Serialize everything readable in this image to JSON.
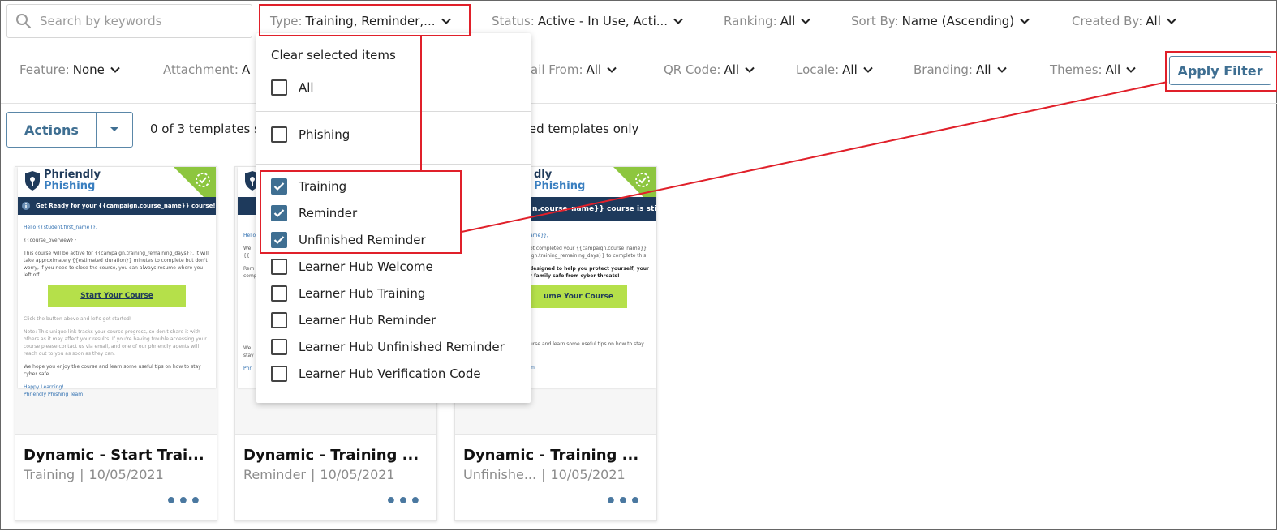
{
  "search": {
    "placeholder": "Search by keywords"
  },
  "filters_row1": [
    {
      "label": "Type:",
      "value": "Training, Reminder,..."
    },
    {
      "label": "Status:",
      "value": "Active - In Use, Acti..."
    },
    {
      "label": "Ranking:",
      "value": "All"
    },
    {
      "label": "Sort By:",
      "value": "Name (Ascending)"
    },
    {
      "label": "Created By:",
      "value": "All"
    }
  ],
  "filters_row2": [
    {
      "label": "Feature:",
      "value": "None"
    },
    {
      "label": "Attachment:",
      "value": "A"
    },
    {
      "label": "ail From:",
      "value": "All"
    },
    {
      "label": "QR Code:",
      "value": "All"
    },
    {
      "label": "Locale:",
      "value": "All"
    },
    {
      "label": "Branding:",
      "value": "All"
    },
    {
      "label": "Themes:",
      "value": "All"
    }
  ],
  "apply_filter_label": "Apply Filter",
  "actions_label": "Actions",
  "templates_count_text": "0 of 3 templates s",
  "templates_only_text": "ted templates only",
  "type_dropdown": {
    "clear_label": "Clear selected items",
    "all_label": "All",
    "items": [
      {
        "label": "Phishing",
        "checked": false
      },
      {
        "label": "Training",
        "checked": true
      },
      {
        "label": "Reminder",
        "checked": true
      },
      {
        "label": "Unfinished Reminder",
        "checked": true
      },
      {
        "label": "Learner Hub Welcome",
        "checked": false
      },
      {
        "label": "Learner Hub Training",
        "checked": false
      },
      {
        "label": "Learner Hub Reminder",
        "checked": false
      },
      {
        "label": "Learner Hub Unfinished Reminder",
        "checked": false
      },
      {
        "label": "Learner Hub Verification Code",
        "checked": false
      }
    ]
  },
  "cards": [
    {
      "title": "Dynamic - Start Trai...",
      "type": "Training",
      "date": "10/05/2021",
      "preview": {
        "brand_line1": "Phriendly",
        "brand_line2": "Phishing",
        "banner": "Get Ready for your {{campaign.course_name}} course!",
        "greeting": "Hello {{student.first_name}},",
        "overview": "{{course_overview}}",
        "para1": "This course will be active for {{campaign.training_remaining_days}}. It will take approximately {{estimated_duration}} minutes to complete but don't worry, if you need to close the course, you can always resume where you left off.",
        "button": "Start Your Course",
        "para2": "Click the button above and let's get started!",
        "para3": "Note: This unique link tracks your course progress, so don't share it with others as it may affect your results. If you're having trouble accessing your course please contact us via email, and one of our phriendly agents will reach out to you as soon as they can.",
        "para4": "We hope you enjoy the course and learn some useful tips on how to stay cyber safe.",
        "signoff1": "Happy Learning!",
        "signoff2": "Phriendly Phishing Team"
      }
    },
    {
      "title": "Dynamic - Training ...",
      "type": "Reminder",
      "date": "10/05/2021",
      "preview": {
        "brand_line1": "Phriendly",
        "brand_line2": "Phishing",
        "line1": "Hello",
        "line2": "We",
        "line3": "{{",
        "line4": "Rem",
        "line5": "comp",
        "line6": "We",
        "line7": "stay",
        "line8": "Phri"
      }
    },
    {
      "title": "Dynamic - Training ...",
      "type": "Unfinishe...",
      "date": "10/05/2021",
      "preview": {
        "brand_line1": "dly",
        "brand_line2": "Phishing",
        "banner": "n.course_name}} course is still",
        "greeting": "ame}},",
        "para1": "ot completed your {{campaign.course_name}}",
        "para1b": "ign.training_remaining_days}} to complete this",
        "para2": "designed to help you protect yourself, your",
        "para2b": "r family safe from cyber threats!",
        "button": "ume Your Course",
        "para3": "urse and learn some useful tips on how to stay",
        "signoff": "m"
      }
    }
  ],
  "colors": {
    "accent": "#3f6f92",
    "highlight_red": "#e0202a",
    "brand_green": "#8dc63f",
    "button_green": "#b5e04a",
    "banner_navy": "#1e3a5c"
  }
}
